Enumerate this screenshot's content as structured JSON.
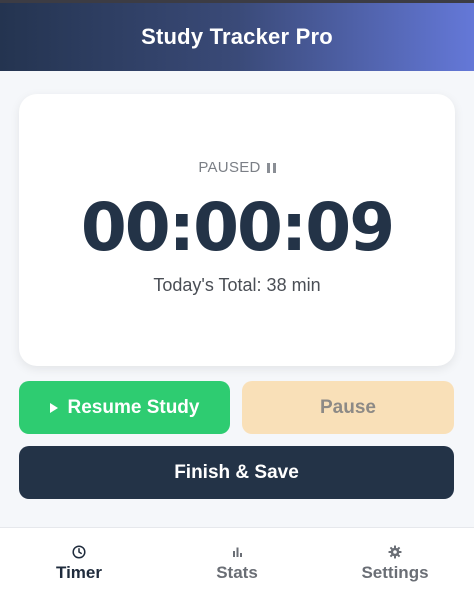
{
  "header": {
    "title": "Study Tracker Pro"
  },
  "timer": {
    "status": "PAUSED",
    "time": "00:00:09",
    "today_total": "Today's Total: 38 min"
  },
  "actions": {
    "resume_label": "Resume Study",
    "pause_label": "Pause",
    "finish_label": "Finish & Save"
  },
  "nav": {
    "items": [
      {
        "label": "Timer",
        "icon": "clock-icon",
        "active": true
      },
      {
        "label": "Stats",
        "icon": "bar-chart-icon",
        "active": false
      },
      {
        "label": "Settings",
        "icon": "gear-icon",
        "active": false
      }
    ]
  },
  "colors": {
    "header_start": "#243450",
    "header_end": "#6478d8",
    "resume": "#2ecc71",
    "pause_disabled": "#f9e0b8",
    "finish": "#233347",
    "timer_text": "#233347"
  }
}
